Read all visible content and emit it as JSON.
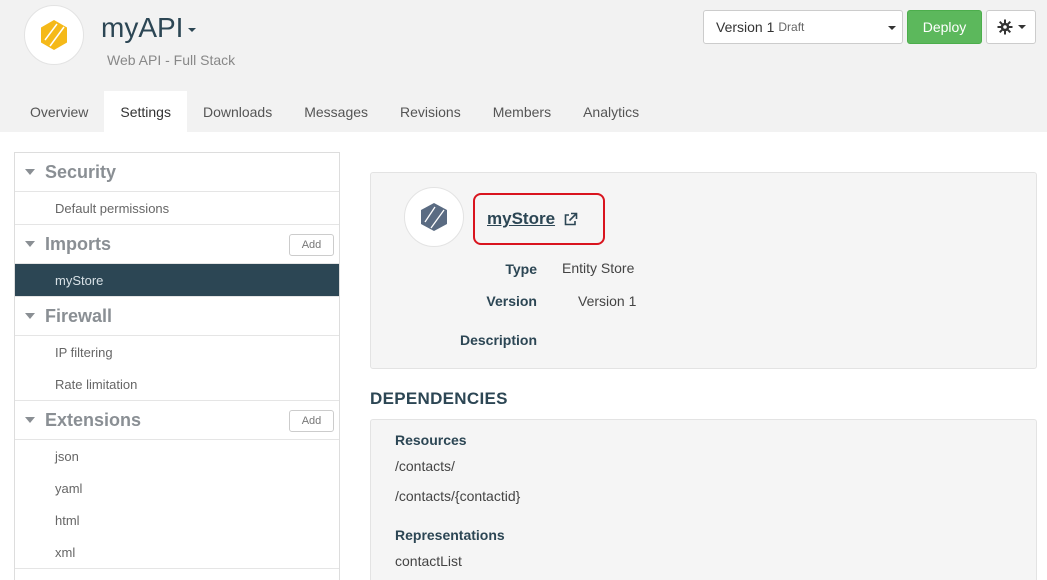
{
  "header": {
    "app_name": "myAPI",
    "subtitle": "Web API - Full Stack",
    "version_label": "Version 1",
    "version_status": "Draft",
    "deploy_label": "Deploy"
  },
  "tabs": [
    {
      "label": "Overview"
    },
    {
      "label": "Settings"
    },
    {
      "label": "Downloads"
    },
    {
      "label": "Messages"
    },
    {
      "label": "Revisions"
    },
    {
      "label": "Members"
    },
    {
      "label": "Analytics"
    }
  ],
  "active_tab": "Settings",
  "sidebar": {
    "security": {
      "title": "Security",
      "items": [
        "Default permissions"
      ]
    },
    "imports": {
      "title": "Imports",
      "add_label": "Add",
      "items": [
        "myStore"
      ]
    },
    "firewall": {
      "title": "Firewall",
      "items": [
        "IP filtering",
        "Rate limitation"
      ]
    },
    "extensions": {
      "title": "Extensions",
      "add_label": "Add",
      "items": [
        "json",
        "yaml",
        "html",
        "xml"
      ]
    }
  },
  "detail": {
    "name": "myStore",
    "type_label": "Type",
    "type_value": "Entity Store",
    "version_label": "Version",
    "version_value": "Version 1",
    "description_label": "Description"
  },
  "dependencies": {
    "title": "DEPENDENCIES",
    "resources_label": "Resources",
    "resources": [
      "/contacts/",
      "/contacts/{contactid}"
    ],
    "representations_label": "Representations",
    "representations": [
      "contactList"
    ]
  },
  "colors": {
    "brand": "#2c4654",
    "accent_logo": "#f5b919",
    "deploy": "#5cb85c",
    "highlight": "#d9141e"
  }
}
